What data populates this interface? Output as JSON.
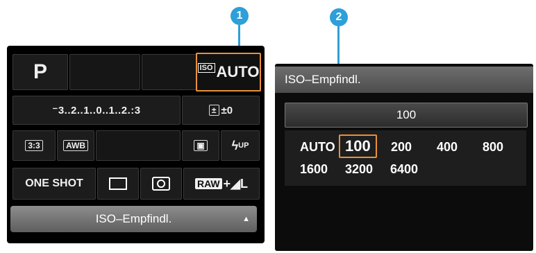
{
  "callouts": [
    "1",
    "2"
  ],
  "left_screen": {
    "shooting_mode": "P",
    "iso_tag": "ISO",
    "iso_value": "AUTO",
    "exposure_scale": "⁻3..2..1..0..1..2.:3",
    "flash_comp": "±0",
    "picture_style": "3:3",
    "white_balance": "AWB",
    "flash_label": "UP",
    "af_mode": "ONE SHOT",
    "quality_raw": "RAW",
    "quality_jpeg": "+◢L",
    "bottom_label": "ISO–Empfindl."
  },
  "right_screen": {
    "title": "ISO–Empfindl.",
    "current_value": "100",
    "options_row1": [
      "AUTO",
      "100",
      "200",
      "400",
      "800"
    ],
    "options_row2": [
      "1600",
      "3200",
      "6400"
    ],
    "selected": "100"
  },
  "colors": {
    "accent": "#e9913d",
    "callout": "#2e9fd8"
  }
}
